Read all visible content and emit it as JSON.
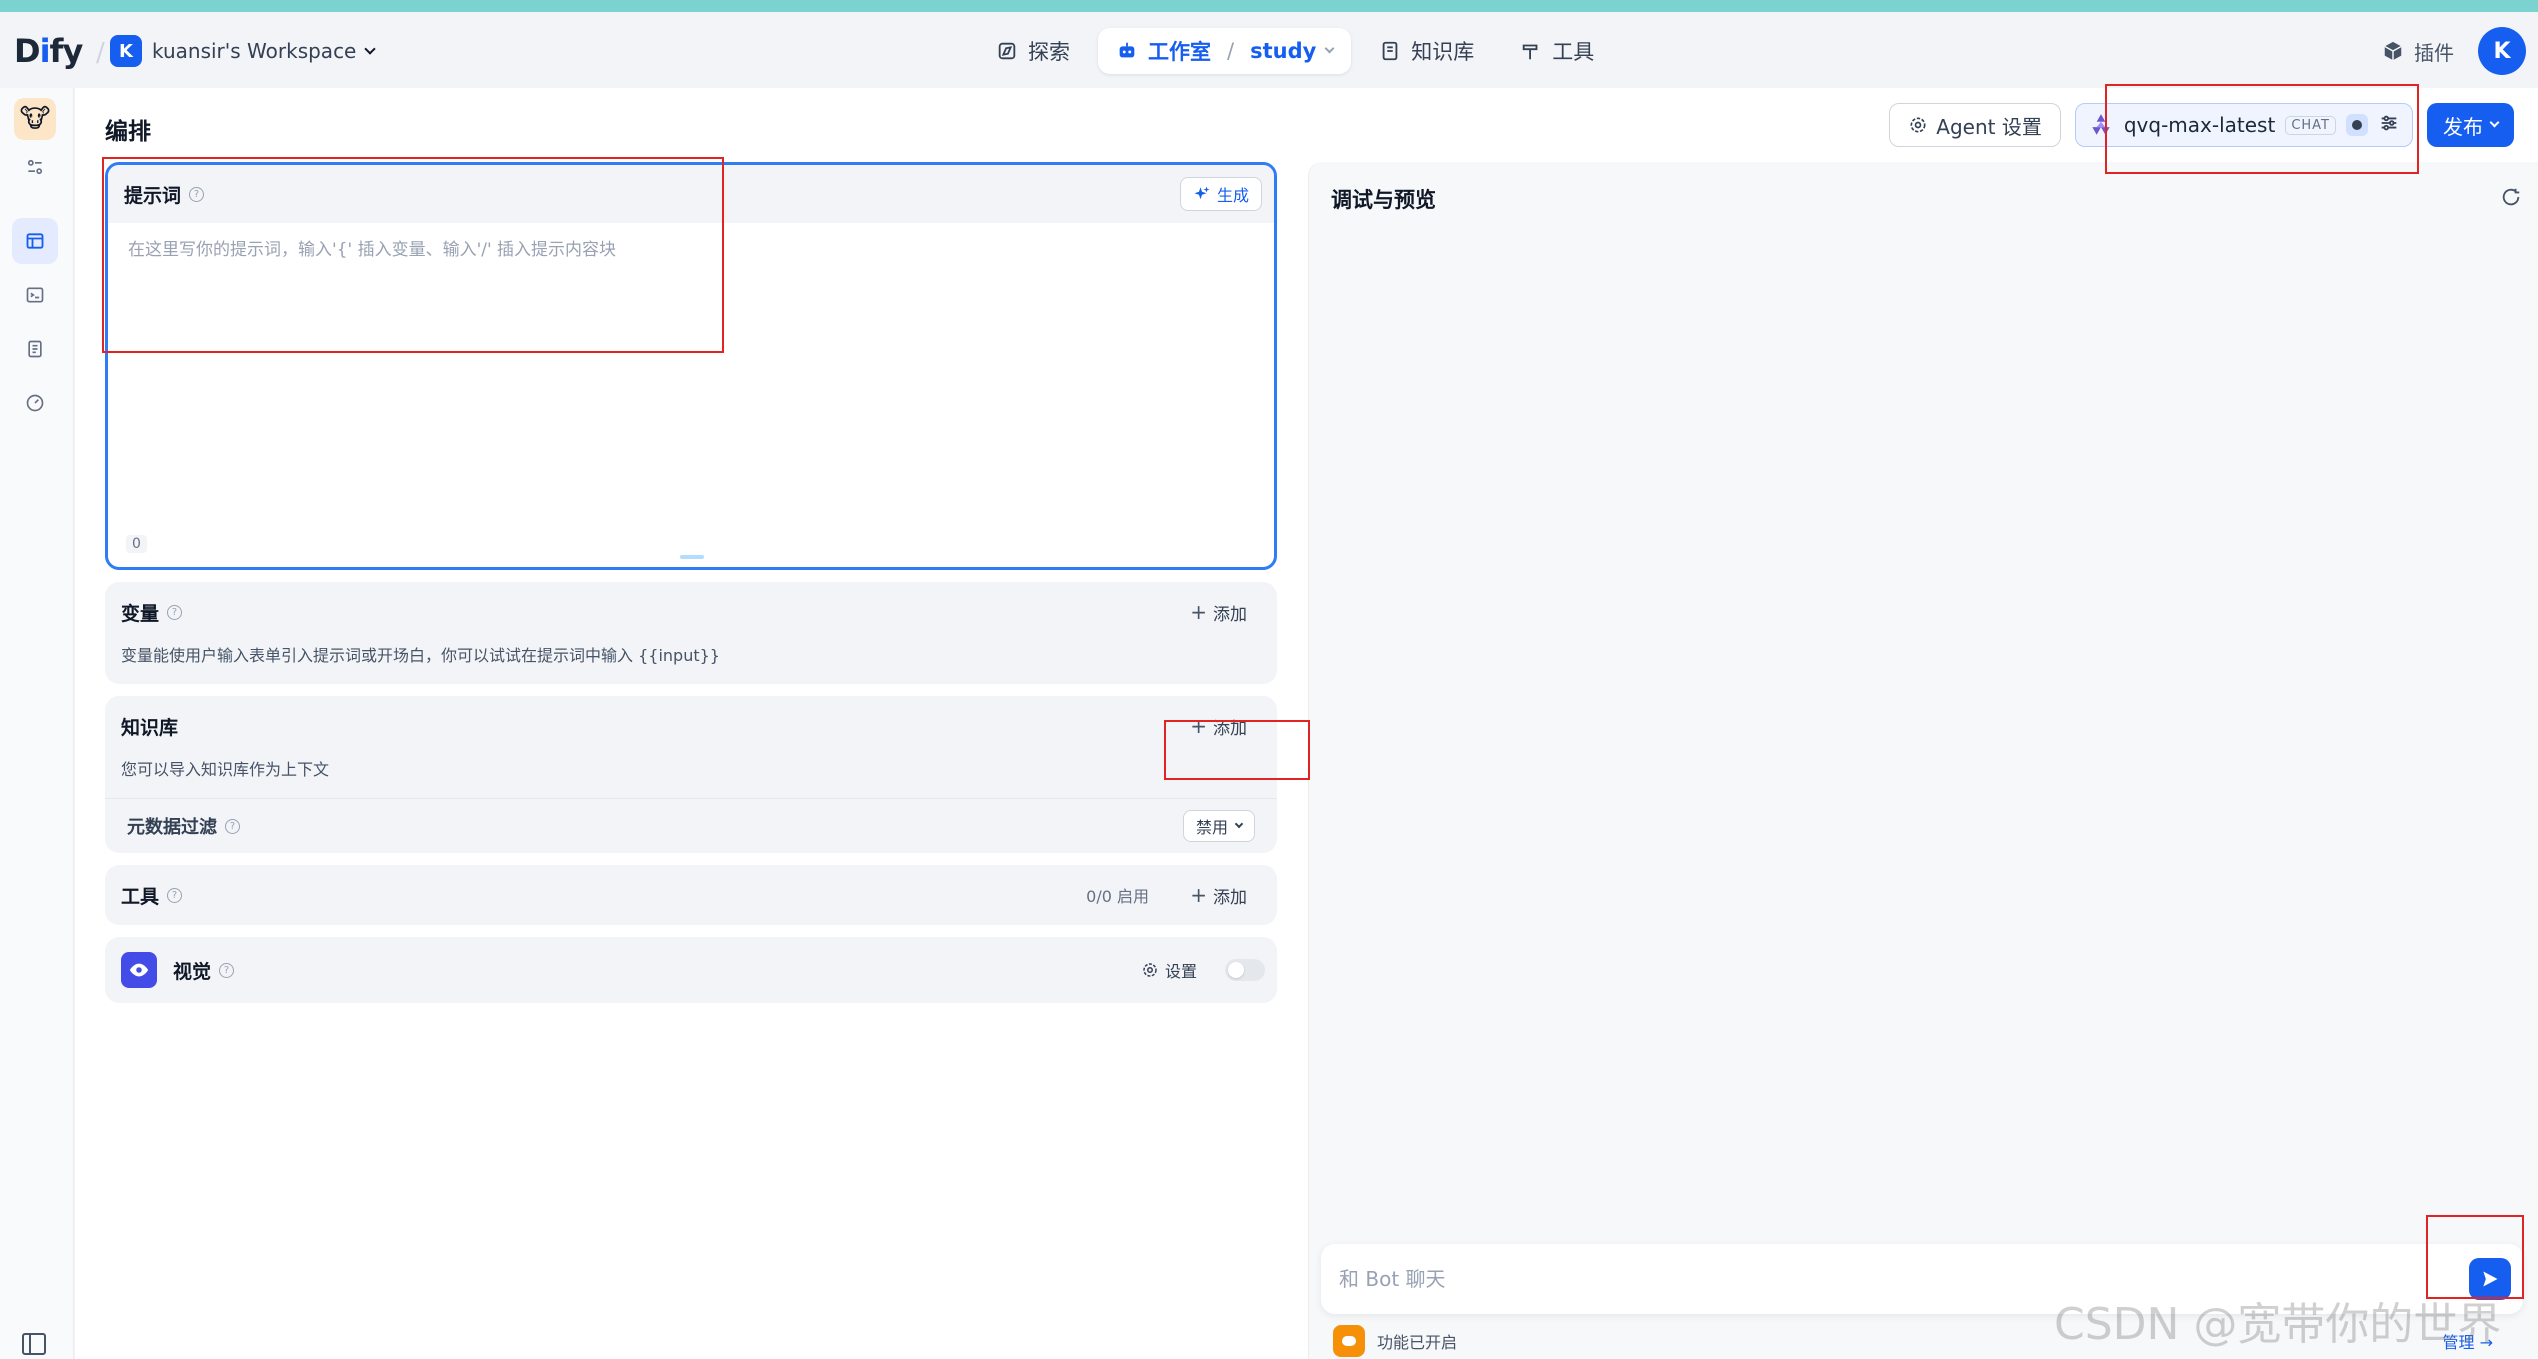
{
  "nav": {
    "logo": "Dify",
    "workspace_initial": "K",
    "workspace_name": "kuansir's Workspace",
    "items": [
      {
        "label": "探索",
        "icon": "compass-icon"
      },
      {
        "label": "工作室",
        "icon": "robot-icon",
        "app": "study"
      },
      {
        "label": "知识库",
        "icon": "book-icon"
      },
      {
        "label": "工具",
        "icon": "hammer-icon"
      }
    ],
    "separator": "/",
    "plugins_label": "插件",
    "user_initial": "K"
  },
  "page": {
    "title": "编排",
    "agent_settings_label": "Agent 设置",
    "model_name": "qvq-max-latest",
    "model_mode": "CHAT",
    "publish_label": "发布"
  },
  "prompt": {
    "title": "提示词",
    "generate_label": "生成",
    "placeholder": "在这里写你的提示词，输入'{' 插入变量、输入'/' 插入提示内容块",
    "value": "",
    "char_count": "0"
  },
  "variables": {
    "title": "变量",
    "add_label": "添加",
    "description": "变量能使用户输入表单引入提示词或开场白，你可以试试在提示词中输入 {{input}}"
  },
  "knowledge": {
    "title": "知识库",
    "add_label": "添加",
    "description": "您可以导入知识库作为上下文",
    "metadata_filter_label": "元数据过滤",
    "metadata_filter_value": "禁用"
  },
  "tools": {
    "title": "工具",
    "enabled_count": "0/0 启用",
    "add_label": "添加"
  },
  "vision": {
    "title": "视觉",
    "settings_label": "设置",
    "enabled": false
  },
  "preview": {
    "title": "调试与预览",
    "chat_placeholder": "和 Bot 聊天",
    "features_text": "功能已开启",
    "manage_label": "管理 →"
  },
  "colors": {
    "accent": "#155eef",
    "prompt_border": "#2e7cf6",
    "annotation": "#e02424",
    "top_strip": "#7bd3cf"
  },
  "watermark": "CSDN @宽带你的世界"
}
